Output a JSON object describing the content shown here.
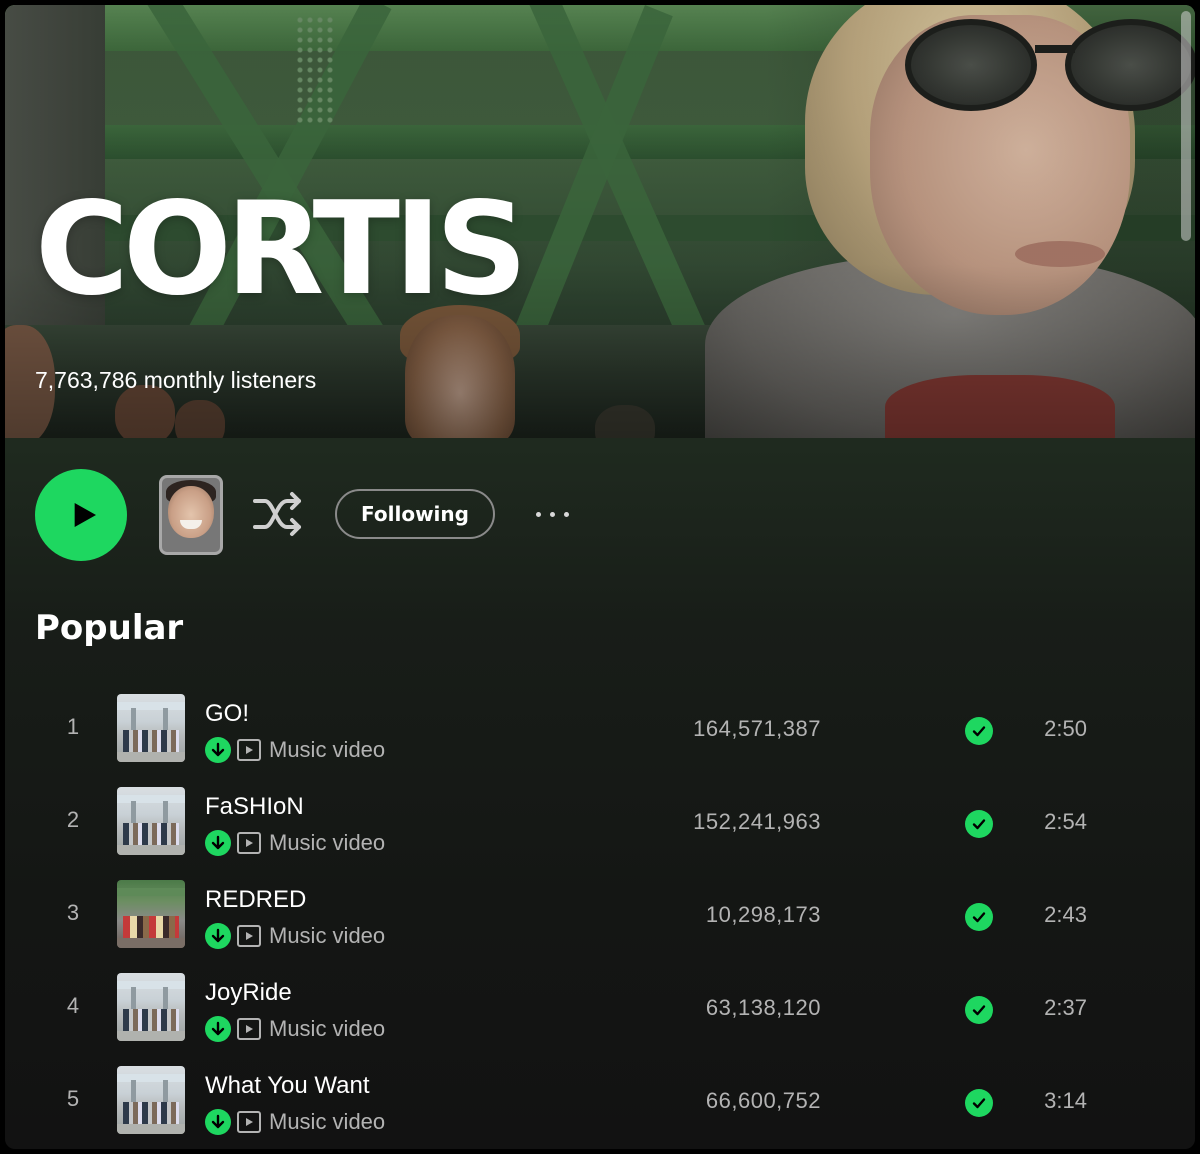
{
  "artist": {
    "name": "CORTIS",
    "monthly_listeners": "7,763,786 monthly listeners"
  },
  "actions": {
    "play_icon": "play-icon",
    "shuffle_icon": "shuffle-icon",
    "follow_label": "Following",
    "more_icon": "more-options-icon"
  },
  "colors": {
    "accent": "#1ed760",
    "text_secondary": "#b3b3b3",
    "background": "#121212"
  },
  "popular": {
    "title": "Popular",
    "tracks": [
      {
        "rank": "1",
        "title": "GO!",
        "badge": "Music video",
        "plays": "164,571,387",
        "duration": "2:50"
      },
      {
        "rank": "2",
        "title": "FaSHIoN",
        "badge": "Music video",
        "plays": "152,241,963",
        "duration": "2:54"
      },
      {
        "rank": "3",
        "title": "REDRED",
        "badge": "Music video",
        "plays": "10,298,173",
        "duration": "2:43"
      },
      {
        "rank": "4",
        "title": "JoyRide",
        "badge": "Music video",
        "plays": "63,138,120",
        "duration": "2:37"
      },
      {
        "rank": "5",
        "title": "What You Want",
        "badge": "Music video",
        "plays": "66,600,752",
        "duration": "3:14"
      }
    ]
  }
}
